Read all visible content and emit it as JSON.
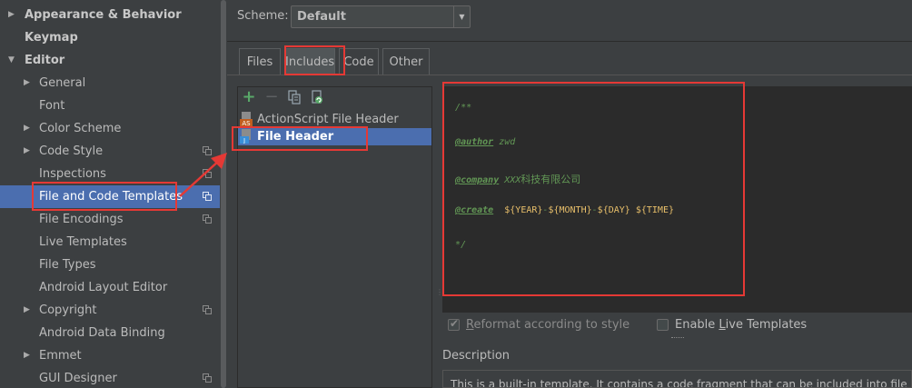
{
  "tree": {
    "items": [
      {
        "label": "Appearance & Behavior",
        "expandable": true,
        "expanded": false,
        "bold": true,
        "level": 0
      },
      {
        "label": "Keymap",
        "expandable": false,
        "bold": true,
        "level": 0
      },
      {
        "label": "Editor",
        "expandable": true,
        "expanded": true,
        "bold": true,
        "level": 0
      },
      {
        "label": "General",
        "expandable": true,
        "expanded": false,
        "level": 1
      },
      {
        "label": "Font",
        "expandable": false,
        "level": 1
      },
      {
        "label": "Color Scheme",
        "expandable": true,
        "expanded": false,
        "level": 1
      },
      {
        "label": "Code Style",
        "expandable": true,
        "expanded": false,
        "level": 1,
        "project_icon": true
      },
      {
        "label": "Inspections",
        "expandable": false,
        "level": 1,
        "project_icon": true
      },
      {
        "label": "File and Code Templates",
        "expandable": false,
        "level": 1,
        "project_icon": true,
        "selected": true
      },
      {
        "label": "File Encodings",
        "expandable": false,
        "level": 1,
        "project_icon": true
      },
      {
        "label": "Live Templates",
        "expandable": false,
        "level": 1
      },
      {
        "label": "File Types",
        "expandable": false,
        "level": 1
      },
      {
        "label": "Android Layout Editor",
        "expandable": false,
        "level": 1
      },
      {
        "label": "Copyright",
        "expandable": true,
        "expanded": false,
        "level": 1,
        "project_icon": true
      },
      {
        "label": "Android Data Binding",
        "expandable": false,
        "level": 1
      },
      {
        "label": "Emmet",
        "expandable": true,
        "expanded": false,
        "level": 1
      },
      {
        "label": "GUI Designer",
        "expandable": false,
        "level": 1,
        "project_icon": true
      }
    ]
  },
  "scheme": {
    "label": "Scheme:",
    "value": "Default"
  },
  "tabs": [
    {
      "label": "Files",
      "active": false
    },
    {
      "label": "Includes",
      "active": true
    },
    {
      "label": "Code",
      "active": false
    },
    {
      "label": "Other",
      "active": false
    }
  ],
  "toolbar": {
    "add": "+",
    "remove": "−"
  },
  "templates": [
    {
      "label": "ActionScript File Header",
      "icon_text": "AS",
      "selected": false
    },
    {
      "label": "File Header",
      "icon_text": "J",
      "selected": true
    }
  ],
  "editor": {
    "l1": "/**",
    "l2_tag": "@author",
    "l2_val": " zwd",
    "l3_tag": "@company",
    "l3_val_a": " XXX",
    "l3_val_b": "科技有限公司",
    "l4_tag": "@create",
    "l4_sp": "  ",
    "l4_d1": "$",
    "l4_v1": "{YEAR}",
    "l4_s1": "-",
    "l4_d2": "$",
    "l4_v2": "{MONTH}",
    "l4_s2": "-",
    "l4_d3": "$",
    "l4_v3": "{DAY}",
    "l4_sp2": " ",
    "l4_d4": "$",
    "l4_v4": "{TIME}",
    "l5": "*/"
  },
  "options": {
    "reformat": {
      "label_pre": "",
      "mnemonic": "R",
      "label_post": "eformat according to style",
      "checked": true,
      "enabled": false
    },
    "live_templates": {
      "label_pre": "Enable ",
      "mnemonic": "L",
      "label_post": "ive Templates",
      "checked": false,
      "enabled": true
    }
  },
  "description": {
    "label": "Description",
    "text": "This is a built-in template. It contains a code fragment that can be included into file"
  },
  "colors": {
    "background": "#3c3f41",
    "selection": "#4b6eaf",
    "editor_bg": "#2b2b2b",
    "annotation_red": "#e53935",
    "comment_green": "#629755",
    "variable_yellow": "#e8bf6a",
    "add_green": "#59a869"
  },
  "icons": {
    "expand_collapsed": "triangle-right",
    "expand_open": "triangle-down",
    "copy": "copy-icon",
    "reset": "reset-icon"
  }
}
